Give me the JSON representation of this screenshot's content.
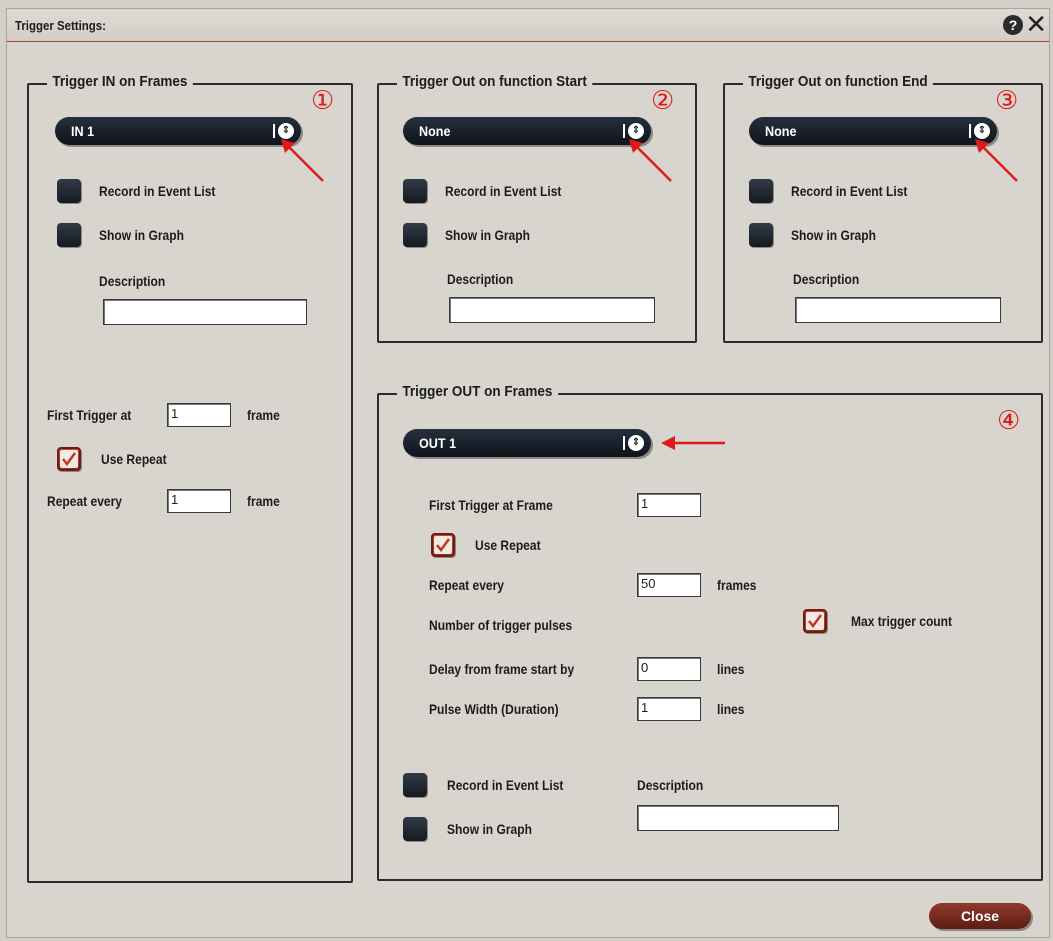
{
  "window": {
    "title": "Trigger Settings:",
    "help_icon": "?",
    "close_icon": "✕"
  },
  "groups": {
    "trigger_in": {
      "title": "Trigger IN on Frames",
      "marker": "①",
      "dropdown_value": "IN 1",
      "record_label": "Record in Event List",
      "graph_label": "Show in Graph",
      "description_label": "Description",
      "description_value": "",
      "first_trigger_label": "First Trigger at",
      "first_trigger_value": "1",
      "first_trigger_unit": "frame",
      "use_repeat_label": "Use Repeat",
      "repeat_label": "Repeat every",
      "repeat_value": "1",
      "repeat_unit": "frame"
    },
    "trigger_out_start": {
      "title": "Trigger Out on function Start",
      "marker": "②",
      "dropdown_value": "None",
      "record_label": "Record in Event List",
      "graph_label": "Show in Graph",
      "description_label": "Description",
      "description_value": ""
    },
    "trigger_out_end": {
      "title": "Trigger Out on function End",
      "marker": "③",
      "dropdown_value": "None",
      "record_label": "Record in Event List",
      "graph_label": "Show in Graph",
      "description_label": "Description",
      "description_value": ""
    },
    "trigger_out_frames": {
      "title": "Trigger OUT on Frames",
      "marker": "④",
      "dropdown_value": "OUT 1",
      "first_trigger_label": "First Trigger at Frame",
      "first_trigger_value": "1",
      "use_repeat_label": "Use Repeat",
      "repeat_label": "Repeat every",
      "repeat_value": "50",
      "repeat_unit": "frames",
      "pulses_label": "Number of trigger pulses",
      "max_count_label": "Max trigger count",
      "delay_label": "Delay from frame start by",
      "delay_value": "0",
      "delay_unit": "lines",
      "pulse_width_label": "Pulse Width (Duration)",
      "pulse_width_value": "1",
      "pulse_width_unit": "lines",
      "record_label": "Record in Event List",
      "graph_label": "Show in Graph",
      "description_label": "Description",
      "description_value": ""
    }
  },
  "close_button": "Close",
  "colors": {
    "accent_red": "#e01919",
    "close_button": "#7a2a1c",
    "title_rule": "#b0431e"
  }
}
